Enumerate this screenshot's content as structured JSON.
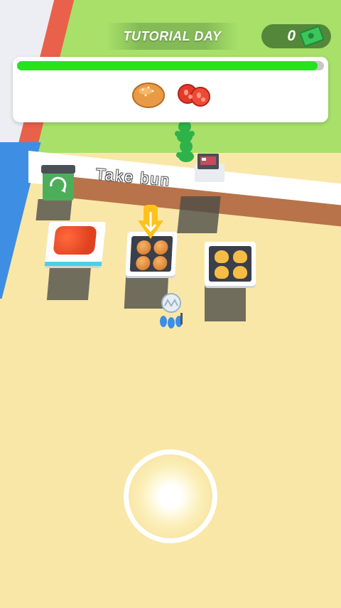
{
  "hud": {
    "title": "TUTORIAL DAY",
    "money": "0",
    "money_icon": "cash-icon"
  },
  "order": {
    "progress": 0.98,
    "progress_color": "#27e21f",
    "items": [
      "bun-icon",
      "tomato-slices-icon"
    ]
  },
  "hint": {
    "text": "Take bun"
  },
  "stations": [
    "tomato-station",
    "bun-station",
    "cheese-station",
    "trash-bin",
    "cash-register"
  ],
  "colors": {
    "grass": "#a8e06a",
    "floor": "#f9e7a8",
    "player": "#3a8ee8",
    "customer": "#2fb24a",
    "arrow": "#ffc21a"
  }
}
